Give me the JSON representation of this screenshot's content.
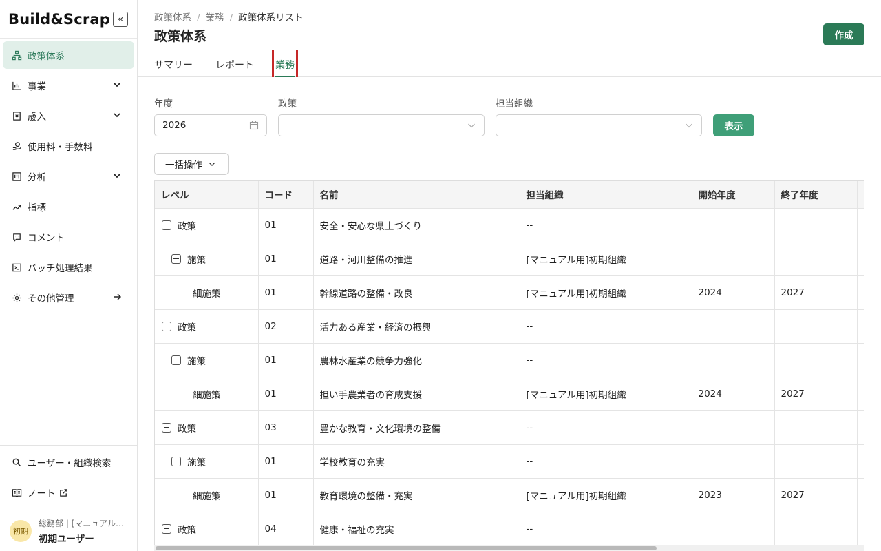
{
  "app": {
    "logo": "Build&Scrap",
    "collapse_glyph": "«"
  },
  "sidebar": {
    "items": [
      {
        "label": "政策体系",
        "icon": "hierarchy-icon",
        "active": true
      },
      {
        "label": "事業",
        "icon": "bar-chart-icon",
        "expandable": true
      },
      {
        "label": "歳入",
        "icon": "receipt-icon",
        "expandable": true
      },
      {
        "label": "使用料・手数料",
        "icon": "coin-hand-icon"
      },
      {
        "label": "分析",
        "icon": "board-icon",
        "expandable": true
      },
      {
        "label": "指標",
        "icon": "trend-icon"
      },
      {
        "label": "コメント",
        "icon": "chat-icon"
      },
      {
        "label": "バッチ処理結果",
        "icon": "terminal-icon"
      },
      {
        "label": "その他管理",
        "icon": "gear-icon",
        "arrow": true
      }
    ],
    "bottom": [
      {
        "label": "ユーザー・組織検索",
        "icon": "search-icon"
      },
      {
        "label": "ノート",
        "icon": "book-icon",
        "external": true
      }
    ],
    "user": {
      "avatar": "初期",
      "dept": "総務部 | [マニュアル…",
      "name": "初期ユーザー"
    }
  },
  "header": {
    "breadcrumb": [
      "政策体系",
      "業務",
      "政策体系リスト"
    ],
    "title": "政策体系",
    "create_label": "作成"
  },
  "tabs": [
    {
      "label": "サマリー"
    },
    {
      "label": "レポート"
    },
    {
      "label": "業務",
      "active": true
    }
  ],
  "filters": {
    "year_label": "年度",
    "year_value": "2026",
    "policy_label": "政策",
    "policy_value": "",
    "org_label": "担当組織",
    "org_value": "",
    "show_label": "表示"
  },
  "bulk_label": "一括操作",
  "table": {
    "columns": [
      "レベル",
      "コード",
      "名前",
      "担当組織",
      "開始年度",
      "終了年度",
      ""
    ],
    "rows": [
      {
        "level": "政策",
        "depth": 0,
        "collapsible": true,
        "code": "01",
        "name": "安全・安心な県土づくり",
        "org": "--",
        "start": "",
        "end": ""
      },
      {
        "level": "施策",
        "depth": 1,
        "collapsible": true,
        "code": "01",
        "name": "道路・河川整備の推進",
        "org": "[マニュアル用]初期組織",
        "start": "",
        "end": ""
      },
      {
        "level": "細施策",
        "depth": 2,
        "collapsible": false,
        "code": "01",
        "name": "幹線道路の整備・改良",
        "org": "[マニュアル用]初期組織",
        "start": "2024",
        "end": "2027"
      },
      {
        "level": "政策",
        "depth": 0,
        "collapsible": true,
        "code": "02",
        "name": "活力ある産業・経済の振興",
        "org": "--",
        "start": "",
        "end": ""
      },
      {
        "level": "施策",
        "depth": 1,
        "collapsible": true,
        "code": "01",
        "name": "農林水産業の競争力強化",
        "org": "--",
        "start": "",
        "end": ""
      },
      {
        "level": "細施策",
        "depth": 2,
        "collapsible": false,
        "code": "01",
        "name": "担い手農業者の育成支援",
        "org": "[マニュアル用]初期組織",
        "start": "2024",
        "end": "2027"
      },
      {
        "level": "政策",
        "depth": 0,
        "collapsible": true,
        "code": "03",
        "name": "豊かな教育・文化環境の整備",
        "org": "--",
        "start": "",
        "end": ""
      },
      {
        "level": "施策",
        "depth": 1,
        "collapsible": true,
        "code": "01",
        "name": "学校教育の充実",
        "org": "--",
        "start": "",
        "end": ""
      },
      {
        "level": "細施策",
        "depth": 2,
        "collapsible": false,
        "code": "01",
        "name": "教育環境の整備・充実",
        "org": "[マニュアル用]初期組織",
        "start": "2023",
        "end": "2027"
      },
      {
        "level": "政策",
        "depth": 0,
        "collapsible": true,
        "code": "04",
        "name": "健康・福祉の充実",
        "org": "--",
        "start": "",
        "end": ""
      }
    ]
  }
}
